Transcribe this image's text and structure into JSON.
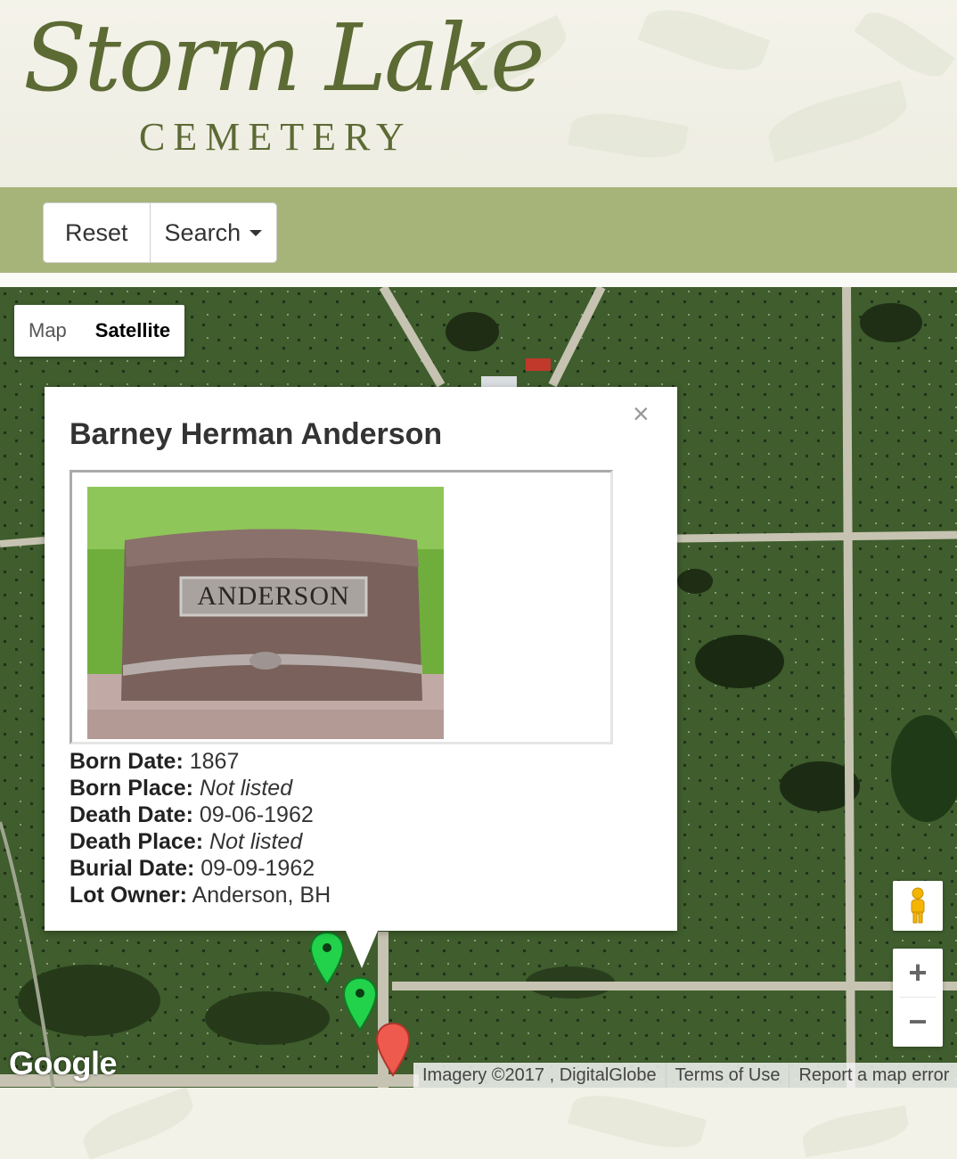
{
  "header": {
    "logo_title": "Storm Lake",
    "logo_subtitle": "CEMETERY"
  },
  "toolbar": {
    "reset_label": "Reset",
    "search_label": "Search"
  },
  "map": {
    "type_control": {
      "options": [
        "Map",
        "Satellite"
      ],
      "selected": "Satellite"
    },
    "google_logo": "Google",
    "attribution": {
      "imagery": "Imagery ©2017 , DigitalGlobe",
      "terms": "Terms of Use",
      "report": "Report a map error"
    },
    "zoom": {
      "in": "+",
      "out": "−"
    }
  },
  "info_window": {
    "title": "Barney Herman Anderson",
    "close": "×",
    "headstone_text": "ANDERSON",
    "details": [
      {
        "label": "Born Date:",
        "value": "1867",
        "italic": false
      },
      {
        "label": "Born Place:",
        "value": "Not listed",
        "italic": true
      },
      {
        "label": "Death Date:",
        "value": "09-06-1962",
        "italic": false
      },
      {
        "label": "Death Place:",
        "value": "Not listed",
        "italic": true
      },
      {
        "label": "Burial Date:",
        "value": "09-09-1962",
        "italic": false
      },
      {
        "label": "Lot Owner:",
        "value": "Anderson, BH",
        "italic": false
      }
    ]
  },
  "colors": {
    "brand_green": "#5c6a34",
    "toolbar_green": "#a6b47a",
    "marker_green": "#22d24a",
    "marker_red": "#ee5a4e"
  }
}
